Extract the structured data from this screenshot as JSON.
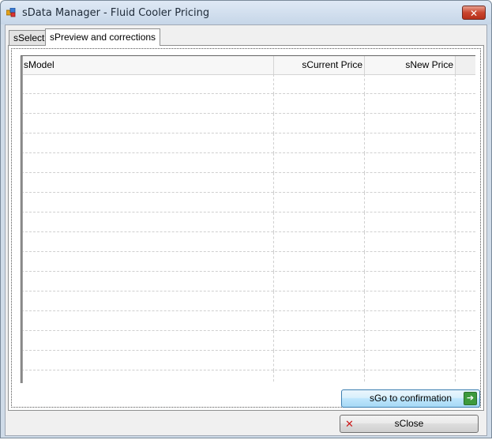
{
  "window": {
    "title": "sData Manager - Fluid Cooler Pricing",
    "close_glyph": "✕"
  },
  "tabs": [
    {
      "label": "sSelect",
      "active": false
    },
    {
      "label": "sPreview and corrections",
      "active": true
    }
  ],
  "grid": {
    "columns": [
      "sModel",
      "sCurrent Price",
      "sNew Price"
    ],
    "rows": []
  },
  "buttons": {
    "go_confirmation": "sGo to confirmation",
    "close": "sClose"
  },
  "icons": {
    "go": "arrow-right-icon",
    "close": "red-x-icon"
  },
  "colors": {
    "title_bar": "#cfdbe8",
    "close_button": "#c9452e",
    "go_icon": "#3d9a3d"
  }
}
